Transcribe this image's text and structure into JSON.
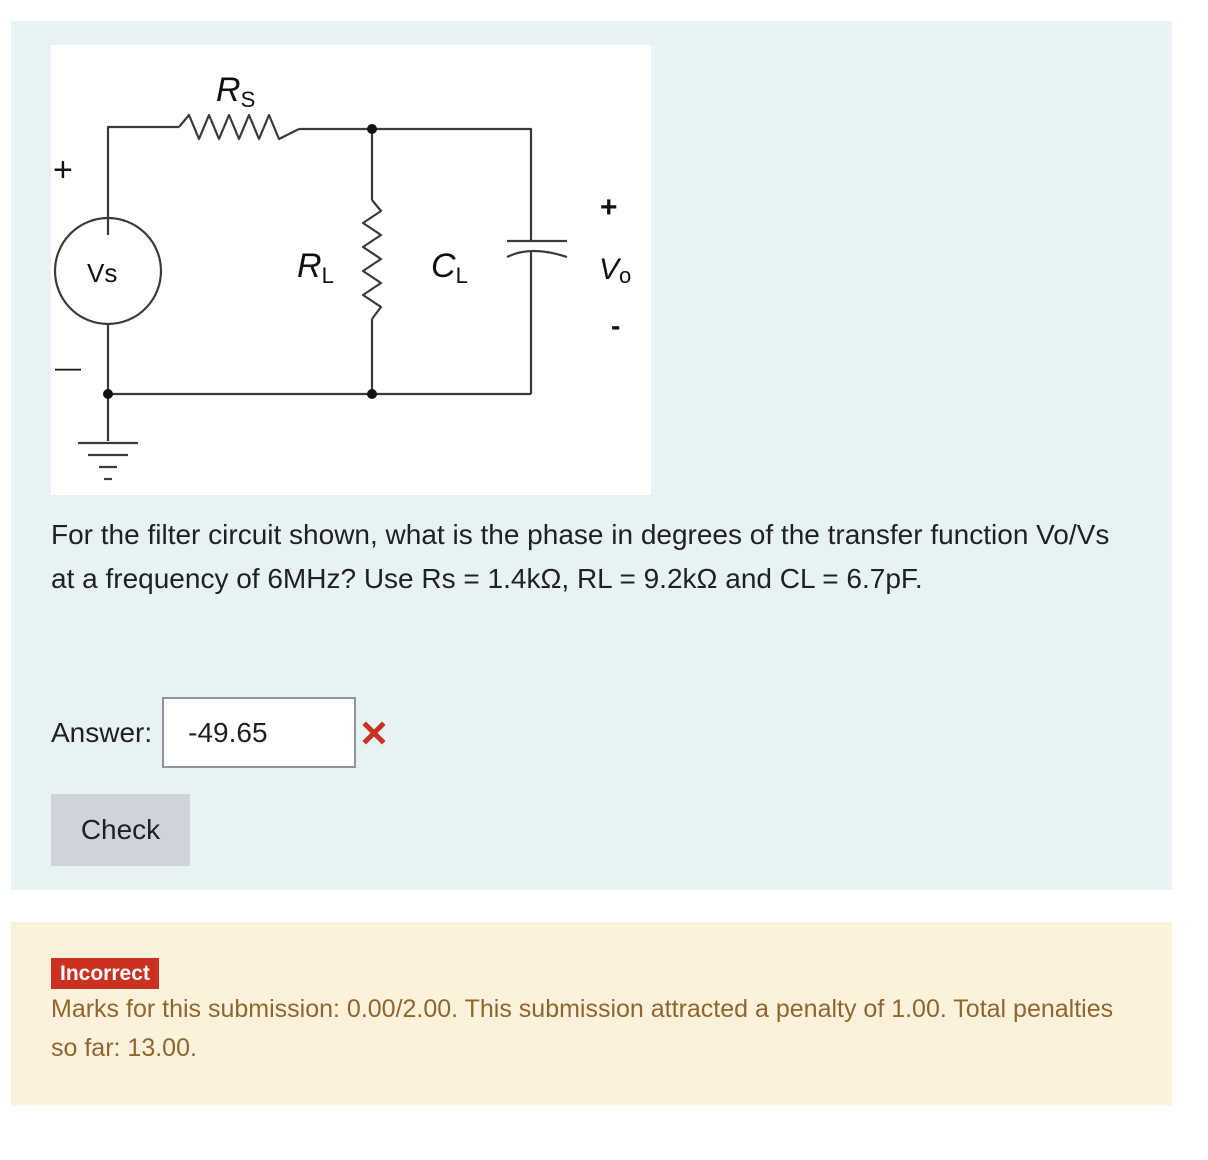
{
  "question": {
    "circuit": {
      "labels": {
        "source": "Vs",
        "series_resistor_main": "R",
        "series_resistor_sub": "S",
        "load_resistor_main": "R",
        "load_resistor_sub": "L",
        "load_capacitor_main": "C",
        "load_capacitor_sub": "L",
        "output_main": "V",
        "output_sub": "o",
        "source_plus": "+",
        "source_minus": "—",
        "output_plus": "+",
        "output_minus": "-"
      }
    },
    "text": "For the filter circuit shown, what is the phase in degrees of the transfer function Vo/Vs at a frequency of 6MHz? Use Rs = 1.4kΩ, RL = 9.2kΩ and CL = 6.7pF.",
    "answer_label": "Answer:",
    "answer_value": "-49.65",
    "answer_status_icon": "cross-icon",
    "check_label": "Check"
  },
  "feedback": {
    "badge": "Incorrect",
    "text": "Marks for this submission: 0.00/2.00. This submission attracted a penalty of 1.00. Total penalties so far: 13.00."
  },
  "colors": {
    "question_bg": "#e7f2f5",
    "feedback_bg": "#fcf2dc",
    "badge_bg": "#ca3120",
    "feedback_text": "#8e662e",
    "incorrect_icon": "#ca3120",
    "button_bg": "#ced4da"
  }
}
